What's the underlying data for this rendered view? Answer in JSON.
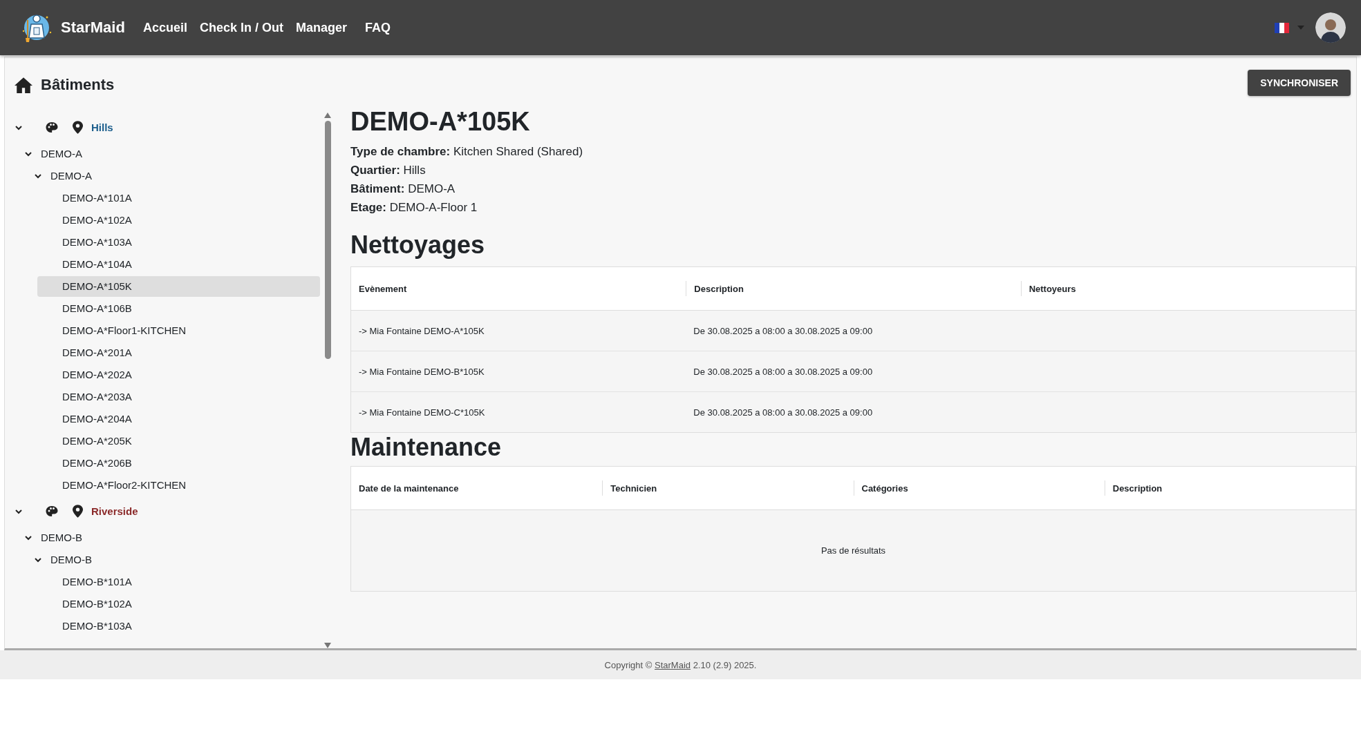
{
  "navbar": {
    "brand": "StarMaid",
    "links": [
      "Accueil",
      "Check In / Out",
      "Manager",
      "FAQ"
    ]
  },
  "sidebar": {
    "title": "Bâtiments",
    "tree": [
      {
        "kind": "neighborhood",
        "label": "Hills",
        "color": "#1b5e8c",
        "expanded": true,
        "children": [
          {
            "kind": "building",
            "label": "DEMO-A",
            "expanded": true,
            "children": [
              {
                "kind": "floor",
                "label": "DEMO-A",
                "expanded": true,
                "children": [
                  {
                    "kind": "room",
                    "label": "DEMO-A*101A",
                    "selected": false
                  },
                  {
                    "kind": "room",
                    "label": "DEMO-A*102A",
                    "selected": false
                  },
                  {
                    "kind": "room",
                    "label": "DEMO-A*103A",
                    "selected": false
                  },
                  {
                    "kind": "room",
                    "label": "DEMO-A*104A",
                    "selected": false
                  },
                  {
                    "kind": "room",
                    "label": "DEMO-A*105K",
                    "selected": true
                  },
                  {
                    "kind": "room",
                    "label": "DEMO-A*106B",
                    "selected": false
                  },
                  {
                    "kind": "room",
                    "label": "DEMO-A*Floor1-KITCHEN",
                    "selected": false
                  },
                  {
                    "kind": "room",
                    "label": "DEMO-A*201A",
                    "selected": false
                  },
                  {
                    "kind": "room",
                    "label": "DEMO-A*202A",
                    "selected": false
                  },
                  {
                    "kind": "room",
                    "label": "DEMO-A*203A",
                    "selected": false
                  },
                  {
                    "kind": "room",
                    "label": "DEMO-A*204A",
                    "selected": false
                  },
                  {
                    "kind": "room",
                    "label": "DEMO-A*205K",
                    "selected": false
                  },
                  {
                    "kind": "room",
                    "label": "DEMO-A*206B",
                    "selected": false
                  },
                  {
                    "kind": "room",
                    "label": "DEMO-A*Floor2-KITCHEN",
                    "selected": false
                  }
                ]
              }
            ]
          }
        ]
      },
      {
        "kind": "neighborhood",
        "label": "Riverside",
        "color": "#8b2a2a",
        "expanded": true,
        "children": [
          {
            "kind": "building",
            "label": "DEMO-B",
            "expanded": true,
            "children": [
              {
                "kind": "floor",
                "label": "DEMO-B",
                "expanded": true,
                "children": [
                  {
                    "kind": "room",
                    "label": "DEMO-B*101A",
                    "selected": false
                  },
                  {
                    "kind": "room",
                    "label": "DEMO-B*102A",
                    "selected": false
                  },
                  {
                    "kind": "room",
                    "label": "DEMO-B*103A",
                    "selected": false
                  }
                ]
              }
            ]
          }
        ]
      }
    ]
  },
  "sync_button": "SYNCHRONISER",
  "room": {
    "title": "DEMO-A*105K",
    "details": [
      "**Type de chambre:** Kitchen Shared (Shared)",
      "**Quartier:** Hills",
      "**Bâtiment:** DEMO-A",
      "**Etage:** DEMO-A-Floor 1"
    ]
  },
  "cleanings": {
    "title": "Nettoyages",
    "columns": [
      "Evènement",
      "Description",
      "Nettoyeurs"
    ],
    "rows": [
      [
        "-> Mia Fontaine DEMO-A*105K",
        "De 30.08.2025 a 08:00 a 30.08.2025 a 09:00"
      ],
      [
        "-> Mia Fontaine DEMO-B*105K",
        "De 30.08.2025 a 08:00 a 30.08.2025 a 09:00"
      ],
      [
        "-> Mia Fontaine DEMO-C*105K",
        "De 30.08.2025 a 08:00 a 30.08.2025 a 09:00"
      ]
    ]
  },
  "maintenance": {
    "title": "Maintenance",
    "columns": [
      "Date de la maintenance",
      "Technicien",
      "Catégories",
      "Description"
    ],
    "empty_message": "Pas de résultats"
  },
  "footer": {
    "prefix": "Copyright © ",
    "link": "StarMaid",
    "suffix": " 2.10 (2.9) 2025."
  }
}
